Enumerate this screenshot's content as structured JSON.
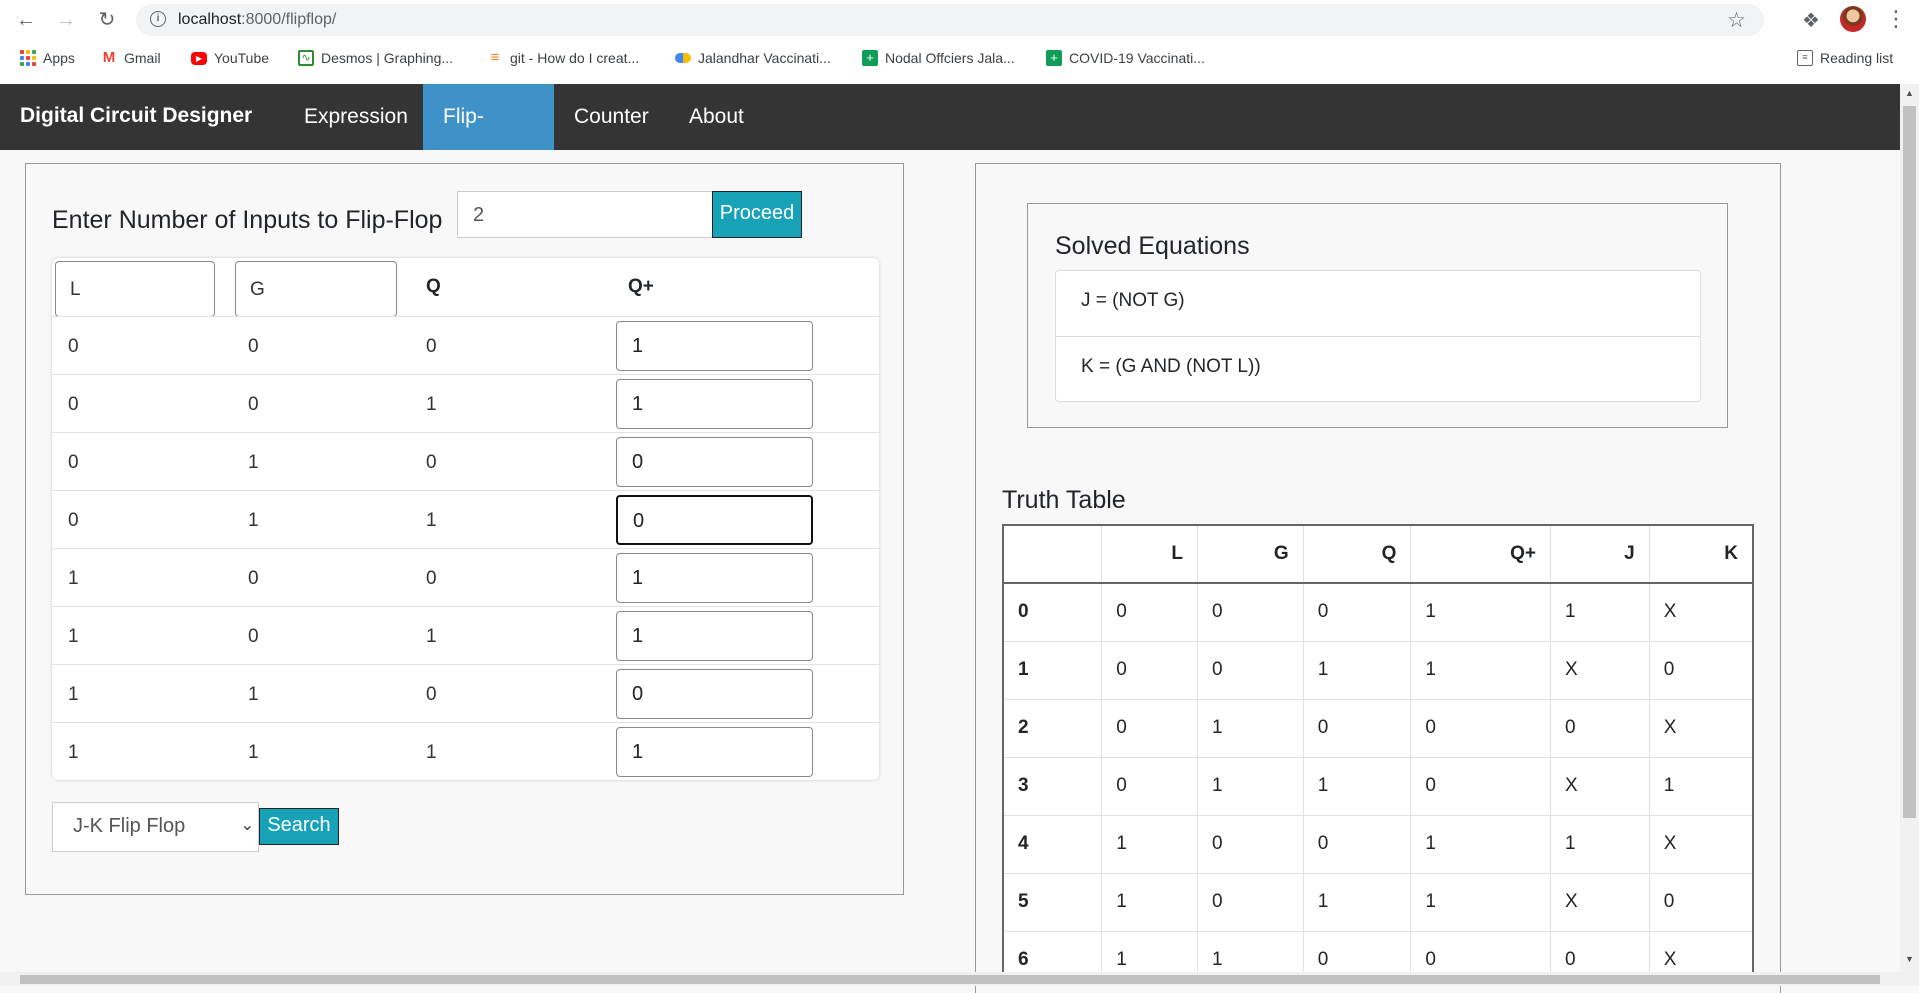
{
  "browser": {
    "url_host": "localhost",
    "url_path": ":8000/flipflop/",
    "bookmarks": [
      {
        "label": "Apps",
        "icon": "apps-grid-icon"
      },
      {
        "label": "Gmail",
        "icon": "gmail-icon"
      },
      {
        "label": "YouTube",
        "icon": "youtube-icon"
      },
      {
        "label": "Desmos | Graphing...",
        "icon": "desmos-icon"
      },
      {
        "label": "git - How do I creat...",
        "icon": "stackoverflow-icon"
      },
      {
        "label": "Jalandhar Vaccinati...",
        "icon": "google-ads-icon"
      },
      {
        "label": "Nodal Offciers Jala...",
        "icon": "sheets-icon"
      },
      {
        "label": "COVID-19 Vaccinati...",
        "icon": "sheets-icon"
      }
    ],
    "reading_list": "Reading list"
  },
  "navbar": {
    "brand": "Digital Circuit Designer",
    "links": [
      "Expression",
      "Flip-Flops",
      "Counter",
      "About"
    ],
    "active": "Flip-Flops",
    "active_color": "#3f92c7",
    "bg_color": "#343434"
  },
  "flipflop_form": {
    "inputs_label": "Enter Number of Inputs to Flip-Flop",
    "num_inputs_value": "2",
    "proceed_label": "Proceed",
    "header_inputs": [
      "L",
      "G"
    ],
    "header_q": "Q",
    "header_qplus": "Q+",
    "rows": [
      {
        "a": "0",
        "b": "0",
        "q": "0",
        "qplus": "1"
      },
      {
        "a": "0",
        "b": "0",
        "q": "1",
        "qplus": "1"
      },
      {
        "a": "0",
        "b": "1",
        "q": "0",
        "qplus": "0"
      },
      {
        "a": "0",
        "b": "1",
        "q": "1",
        "qplus": "0"
      },
      {
        "a": "1",
        "b": "0",
        "q": "0",
        "qplus": "1"
      },
      {
        "a": "1",
        "b": "0",
        "q": "1",
        "qplus": "1"
      },
      {
        "a": "1",
        "b": "1",
        "q": "0",
        "qplus": "0"
      },
      {
        "a": "1",
        "b": "1",
        "q": "1",
        "qplus": "1"
      }
    ],
    "flipflop_type": "J-K Flip Flop",
    "search_label": "Search",
    "button_color": "#17a2b8"
  },
  "solved": {
    "title": "Solved Equations",
    "equations": [
      "J = (NOT G)",
      "K = (G AND (NOT L))"
    ]
  },
  "truth_table": {
    "title": "Truth Table",
    "columns": [
      "",
      "L",
      "G",
      "Q",
      "Q+",
      "J",
      "K"
    ],
    "rows": [
      [
        "0",
        "0",
        "0",
        "0",
        "1",
        "1",
        "X"
      ],
      [
        "1",
        "0",
        "0",
        "1",
        "1",
        "X",
        "0"
      ],
      [
        "2",
        "0",
        "1",
        "0",
        "0",
        "0",
        "X"
      ],
      [
        "3",
        "0",
        "1",
        "1",
        "0",
        "X",
        "1"
      ],
      [
        "4",
        "1",
        "0",
        "0",
        "1",
        "1",
        "X"
      ],
      [
        "5",
        "1",
        "0",
        "1",
        "1",
        "X",
        "0"
      ],
      [
        "6",
        "1",
        "1",
        "0",
        "0",
        "0",
        "X"
      ]
    ]
  }
}
